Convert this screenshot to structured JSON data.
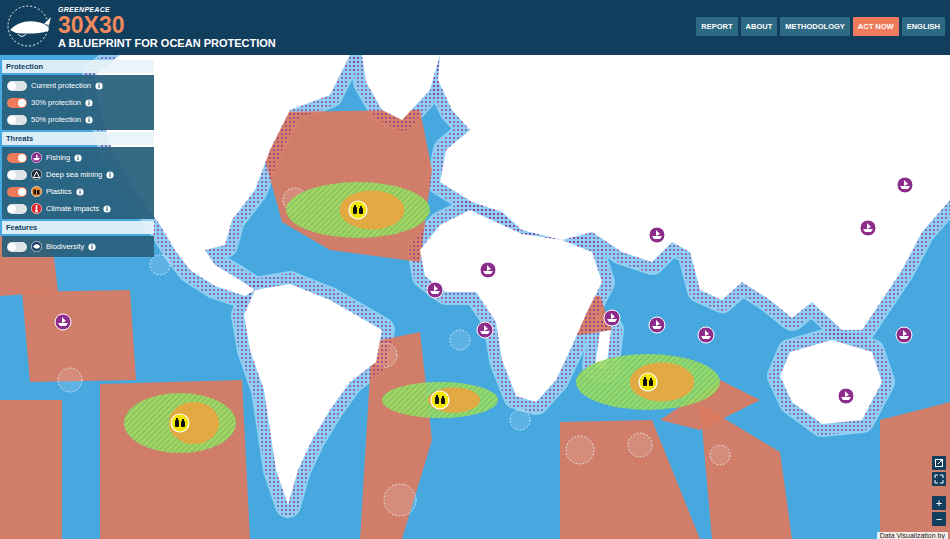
{
  "header": {
    "brand": "GREENPEACE",
    "title": "30X30",
    "subtitle": "A BLUEPRINT FOR OCEAN PROTECTION"
  },
  "nav": [
    {
      "label": "REPORT",
      "selected": false
    },
    {
      "label": "ABOUT",
      "selected": false
    },
    {
      "label": "METHODOLOGY",
      "selected": false
    },
    {
      "label": "ACT NOW",
      "selected": true
    },
    {
      "label": "ENGLISH",
      "selected": false
    }
  ],
  "layers": [
    {
      "title": "Protection",
      "items": [
        {
          "label": "Current protection",
          "on": false,
          "kind": "protection"
        },
        {
          "label": "30% protection",
          "on": true,
          "kind": "protection"
        },
        {
          "label": "50% protection",
          "on": false,
          "kind": "protection"
        }
      ]
    },
    {
      "title": "Threats",
      "items": [
        {
          "label": "Fishing",
          "on": true,
          "kind": "fishing"
        },
        {
          "label": "Deep sea mining",
          "on": false,
          "kind": "mining"
        },
        {
          "label": "Plastics",
          "on": true,
          "kind": "plastics"
        },
        {
          "label": "Climate impacts",
          "on": false,
          "kind": "climate"
        }
      ]
    },
    {
      "title": "Features",
      "items": [
        {
          "label": "Biodiversity",
          "on": false,
          "kind": "biodiversity"
        }
      ]
    }
  ],
  "map_controls": {
    "zoom_in": "+",
    "zoom_out": "−"
  },
  "attribution": "Data Visualization by"
}
